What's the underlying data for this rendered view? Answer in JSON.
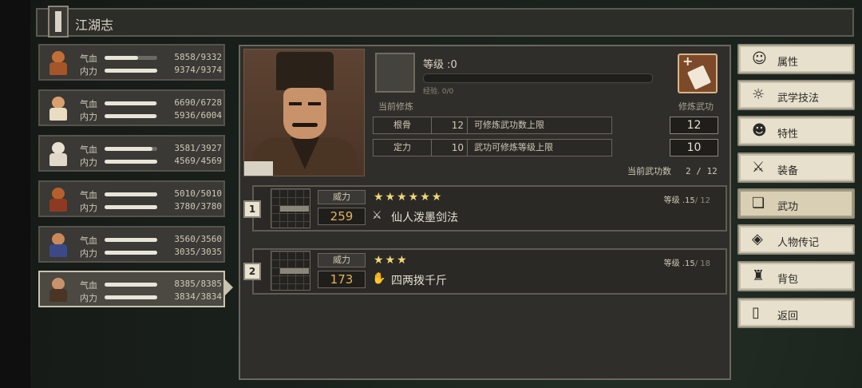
{
  "header": {
    "title": "江湖志"
  },
  "characters": [
    {
      "hp_label": "气血",
      "hp": "5858/9332",
      "hp_frac": 0.63,
      "mp_label": "内力",
      "mp": "9374/9374",
      "mp_frac": 1.0,
      "skin": "#c26e38",
      "clothes": "#a4552a"
    },
    {
      "hp_label": "气血",
      "hp": "6690/6728",
      "hp_frac": 0.99,
      "mp_label": "内力",
      "mp": "5936/6004",
      "mp_frac": 0.99,
      "skin": "#d9a070",
      "clothes": "#e8dcc2"
    },
    {
      "hp_label": "气血",
      "hp": "3581/3927",
      "hp_frac": 0.91,
      "mp_label": "内力",
      "mp": "4569/4569",
      "mp_frac": 1.0,
      "skin": "#e8e0d0",
      "clothes": "#e0d8c8"
    },
    {
      "hp_label": "气血",
      "hp": "5010/5010",
      "hp_frac": 1.0,
      "mp_label": "内力",
      "mp": "3780/3780",
      "mp_frac": 1.0,
      "skin": "#b5602c",
      "clothes": "#8e3a22"
    },
    {
      "hp_label": "气血",
      "hp": "3560/3560",
      "hp_frac": 1.0,
      "mp_label": "内力",
      "mp": "3035/3035",
      "mp_frac": 1.0,
      "skin": "#c9895a",
      "clothes": "#3b4a86"
    },
    {
      "hp_label": "气血",
      "hp": "8385/8385",
      "hp_frac": 1.0,
      "mp_label": "内力",
      "mp": "3834/3834",
      "mp_frac": 1.0,
      "skin": "#c8926a",
      "clothes": "#4a3525"
    }
  ],
  "detail": {
    "level_label": "等级 :0",
    "exp_label": "经验. 0/0",
    "current_cultivate": "当前修炼",
    "practice_label": "修炼武功",
    "attributes": [
      {
        "name": "根骨",
        "value": "12",
        "desc": "可修炼武功数上限",
        "result": "12"
      },
      {
        "name": "定力",
        "value": "10",
        "desc": "武功可修炼等级上限",
        "result": "10"
      }
    ],
    "current_count_label": "当前武功数",
    "current_count": "2 / 12"
  },
  "kungfu": [
    {
      "index": "1",
      "power_label": "威力",
      "power": "259",
      "stars": "★★★★★★",
      "star_count": 6,
      "level": "等级 .15",
      "level_max": "/ 12",
      "icon": "⚔",
      "name": "仙人泼墨剑法"
    },
    {
      "index": "2",
      "power_label": "威力",
      "power": "173",
      "stars": "★★★",
      "star_count": 3,
      "level": "等级 .15",
      "level_max": "/ 18",
      "icon": "✋",
      "name": "四两拨千斤"
    }
  ],
  "menu": [
    {
      "label": "属性",
      "icon": "person-icon",
      "glyph": "☺"
    },
    {
      "label": "武学技法",
      "icon": "martial-icon",
      "glyph": "☼"
    },
    {
      "label": "特性",
      "icon": "trait-icon",
      "glyph": "☻"
    },
    {
      "label": "装备",
      "icon": "sword-icon",
      "glyph": "⚔"
    },
    {
      "label": "武功",
      "icon": "book-icon",
      "glyph": "❏",
      "active": true
    },
    {
      "label": "人物传记",
      "icon": "biography-icon",
      "glyph": "◈"
    },
    {
      "label": "背包",
      "icon": "bag-icon",
      "glyph": "♜"
    },
    {
      "label": "返回",
      "icon": "door-icon",
      "glyph": "▯"
    }
  ]
}
